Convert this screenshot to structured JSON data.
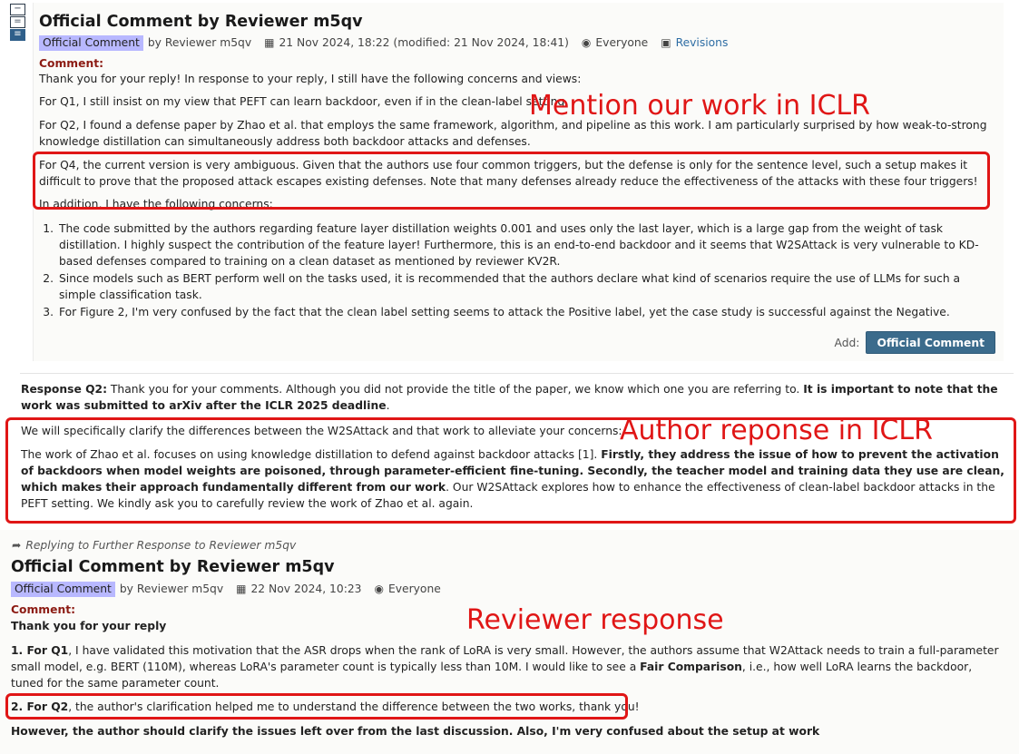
{
  "top": {
    "title": "Official Comment by Reviewer m5qv",
    "badge": "Official Comment",
    "by": "by Reviewer m5qv",
    "date": "21 Nov 2024, 18:22 (modified: 21 Nov 2024, 18:41)",
    "visibility": "Everyone",
    "revisions": "Revisions",
    "comment_label": "Comment:",
    "intro": "Thank you for your reply! In response to your reply, I still have the following concerns and views:",
    "q1": "For Q1, I still insist on my view that PEFT can learn backdoor, even if in the clean-label setting.",
    "q2": "For Q2, I found a defense paper by Zhao et al. that employs the same framework, algorithm, and pipeline as this work. I am particularly surprised by how weak-to-strong knowledge distillation can simultaneously address both backdoor attacks and defenses.",
    "q4": "For Q4, the current version is very ambiguous. Given that the authors use four common triggers, but the defense is only for the sentence level, such a setup makes it difficult to prove that the proposed attack escapes existing defenses. Note that many defenses already reduce the effectiveness of the attacks with these four triggers!",
    "in_addition": "In addition, I have the following concerns:",
    "list": [
      {
        "num": "1.",
        "text": "The code submitted by the authors regarding feature layer distillation weights 0.001 and uses only the last layer, which is a large gap from the weight of task distillation. I highly suspect the contribution of the feature layer! Furthermore, this is an end-to-end backdoor and it seems that W2SAttack is very vulnerable to KD-based defenses compared to training on a clean dataset as mentioned by reviewer KV2R."
      },
      {
        "num": "2.",
        "text": "Since models such as BERT perform well on the tasks used, it is recommended that the authors declare what kind of scenarios require the use of LLMs for such a simple classification task."
      },
      {
        "num": "3.",
        "text": "For Figure 2, I'm very confused by the fact that the clean label setting seems to attack the Positive label, yet the case study is successful against the Negative."
      }
    ],
    "add_label": "Add:",
    "add_button": "Official Comment"
  },
  "middle": {
    "q2_label": "Response Q2:",
    "q2_text": " Thank you for your comments. Although you did not provide the title of the paper, we know which one you are referring to. ",
    "q2_bold": "It is important to note that the work was submitted to arXiv after the ICLR 2025 deadline",
    "q2_end": ".",
    "clarify": "We will specifically clarify the differences between the W2SAttack and that work to alleviate your concerns:",
    "zhao_a": "The work of Zhao et al. focuses on using knowledge distillation to defend against backdoor attacks [1]. ",
    "zhao_b": "Firstly, they address the issue of how to prevent the activation of backdoors when model weights are poisoned, through parameter-efficient fine-tuning. Secondly, the teacher model and training data they use are clean, which makes their approach fundamentally different from our work",
    "zhao_c": ". Our W2SAttack explores how to enhance the effectiveness of clean-label backdoor attacks in the PEFT setting. We kindly ask you to carefully review the work of Zhao et al. again."
  },
  "bottom": {
    "reply_to": "Replying to Further Response to Reviewer m5qv",
    "title": "Official Comment by Reviewer m5qv",
    "badge": "Official Comment",
    "by": "by Reviewer m5qv",
    "date": "22 Nov 2024, 10:23",
    "visibility": "Everyone",
    "comment_label": "Comment:",
    "thanks": "Thank you for your reply",
    "p1_bold": "1. For Q1",
    "p1_a": ", I have validated this motivation that the ASR drops when the rank of LoRA is very small. However, the authors assume that W2Attack needs to train a full-parameter small model, e.g. BERT (110M), whereas LoRA's parameter count is typically less than 10M. I would like to see a ",
    "p1_fair": "Fair Comparison",
    "p1_b": ", i.e., how well LoRA learns the backdoor, tuned for the same parameter count.",
    "p2_bold": "2. For Q2",
    "p2_text": ", the author's clarification helped me to understand the difference between the two works, thank you!",
    "however": "However, the author should clarify the issues left over from the last discussion. Also, I'm very confused about the setup at work"
  },
  "annotations": {
    "iclr": "Mention our work in ICLR",
    "author": "Author reponse in ICLR",
    "reviewer": "Reviewer response",
    "color": "#e01616"
  },
  "colors": {
    "badge": "#b8b8ff",
    "comment_label": "#8c1b13",
    "link": "#2e6da4",
    "button": "#3b6b8c"
  }
}
